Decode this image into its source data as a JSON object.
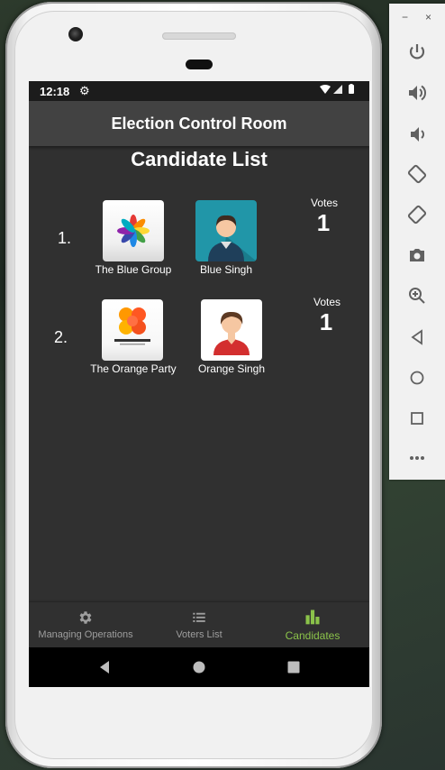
{
  "status_bar": {
    "time": "12:18"
  },
  "app_bar": {
    "title": "Election Control Room"
  },
  "page": {
    "heading": "Candidate List"
  },
  "candidates": [
    {
      "number": "1.",
      "party": "The Blue Group",
      "candidate": "Blue Singh",
      "votes_label": "Votes",
      "votes": "1",
      "color": "#2196a8"
    },
    {
      "number": "2.",
      "party": "The Orange Party",
      "candidate": "Orange Singh",
      "votes_label": "Votes",
      "votes": "1",
      "color": "#ff7a00"
    }
  ],
  "bottom_nav": {
    "items": [
      {
        "label": "Managing Operations",
        "icon": "gear-icon",
        "active": false
      },
      {
        "label": "Voters List",
        "icon": "list-icon",
        "active": false
      },
      {
        "label": "Candidates",
        "icon": "bar-chart-icon",
        "active": true
      }
    ],
    "active_color": "#8bc34a",
    "inactive_color": "#9e9e9e"
  },
  "emulator_panel": {
    "window_controls": [
      "−",
      "×"
    ],
    "tools": [
      "power-icon",
      "volume-up-icon",
      "volume-down-icon",
      "rotate-left-icon",
      "rotate-right-icon",
      "camera-icon",
      "zoom-icon",
      "back-icon",
      "home-icon",
      "overview-icon",
      "more-icon"
    ]
  }
}
